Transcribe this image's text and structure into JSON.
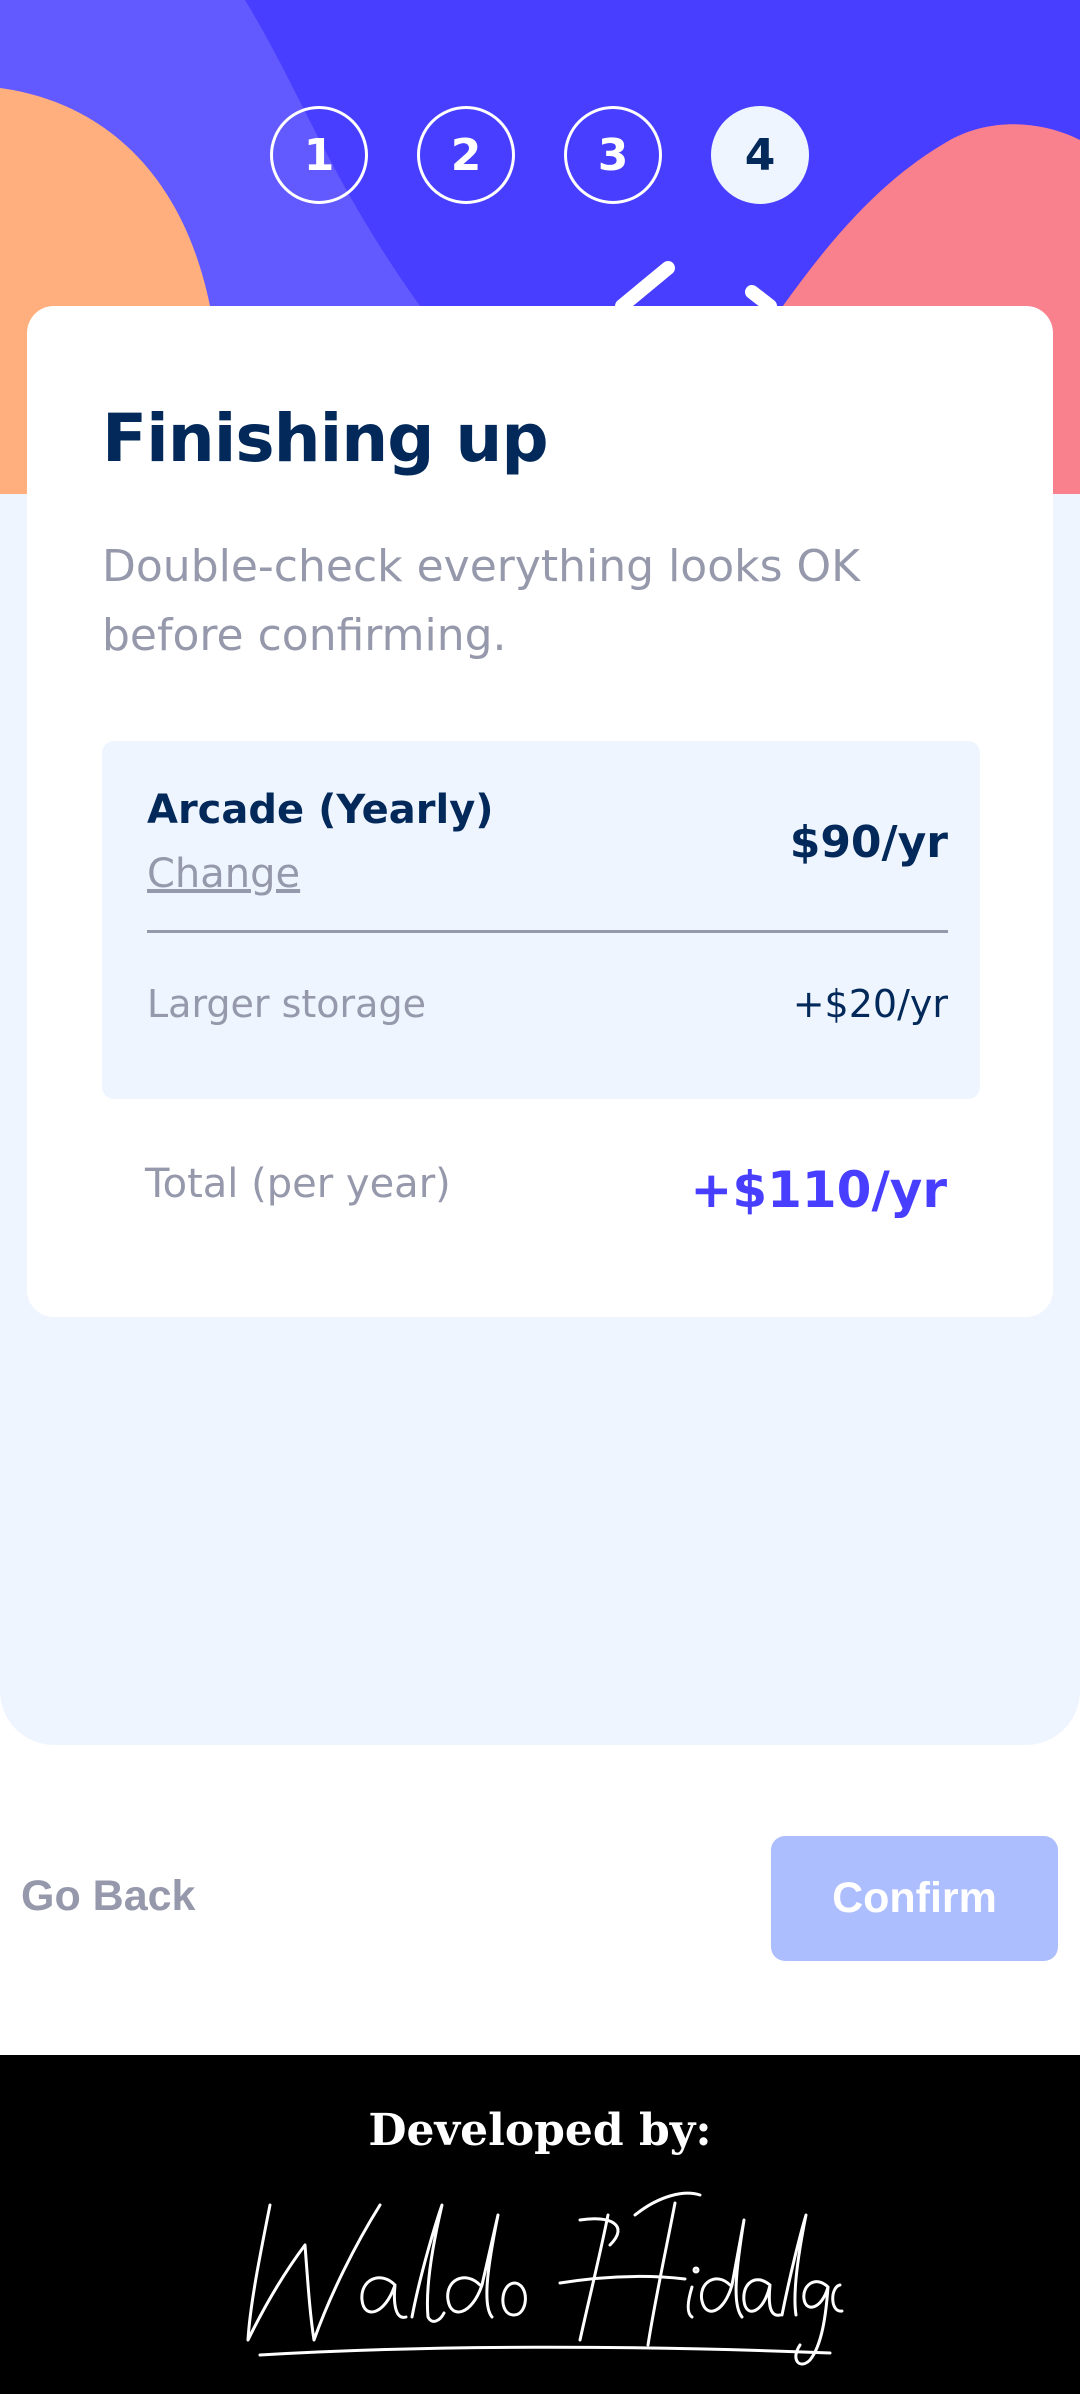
{
  "steps": [
    {
      "number": "1",
      "active": false
    },
    {
      "number": "2",
      "active": false
    },
    {
      "number": "3",
      "active": false
    },
    {
      "number": "4",
      "active": true
    }
  ],
  "summary_page": {
    "title": "Finishing up",
    "subtitle": "Double-check everything looks OK before confirming.",
    "plan": {
      "name": "Arcade (Yearly)",
      "change_label": "Change",
      "price": "$90/yr"
    },
    "addons": [
      {
        "name": "Larger storage",
        "price": "+$20/yr"
      }
    ],
    "total": {
      "label": "Total (per year)",
      "price": "+$110/yr"
    }
  },
  "actions": {
    "back_label": "Go Back",
    "confirm_label": "Confirm"
  },
  "footer": {
    "developed_by": "Developed by:",
    "signature": "Waldo Hidalgo."
  },
  "colors": {
    "header_purple": "#483eff",
    "header_light_purple": "#6259ff",
    "shape_orange": "#ffaf7e",
    "shape_pink": "#f9818e",
    "marine_blue": "#02295a",
    "cool_gray": "#9699ab",
    "page_background": "#eff5ff",
    "confirm_button": "#adbeff"
  }
}
